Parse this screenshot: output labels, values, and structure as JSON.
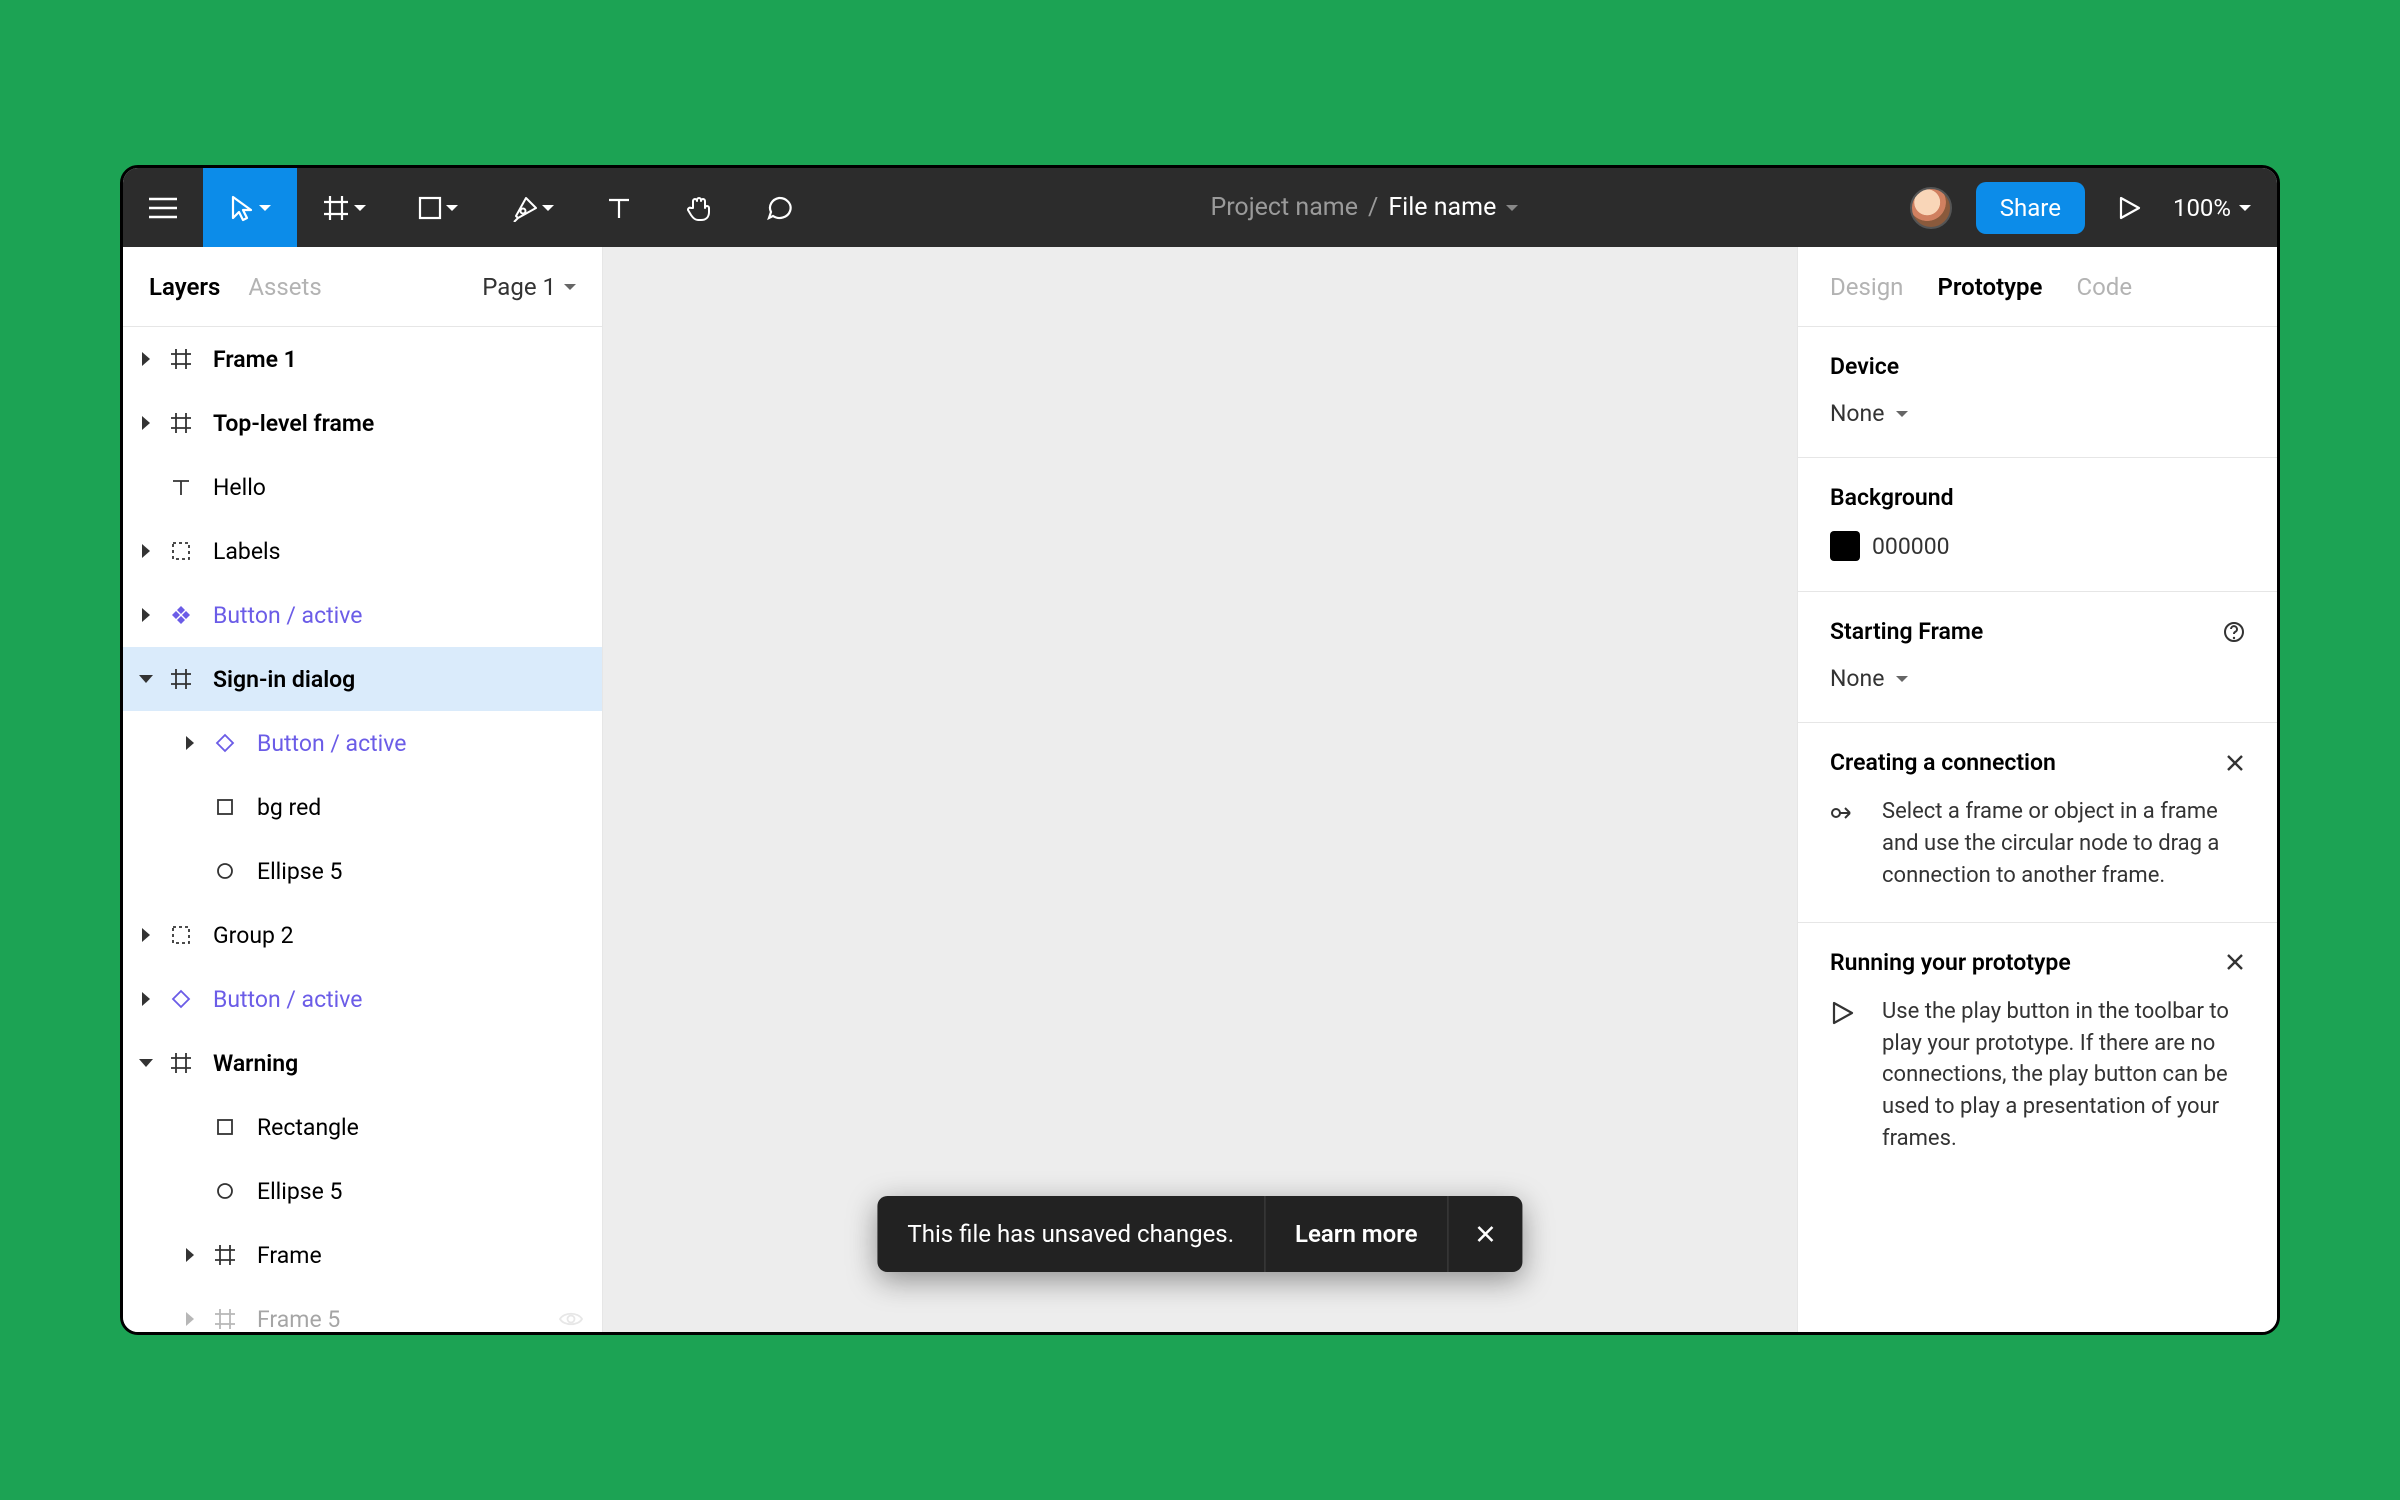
{
  "toolbar": {
    "project_name": "Project name",
    "file_separator": "/",
    "file_name": "File name",
    "share_label": "Share",
    "zoom": "100%"
  },
  "left": {
    "tabs": {
      "layers": "Layers",
      "assets": "Assets"
    },
    "page_label": "Page 1",
    "layers": [
      {
        "label": "Frame 1",
        "bold": true,
        "icon": "frame",
        "arrow": "right",
        "indent": 0
      },
      {
        "label": "Top-level frame",
        "bold": true,
        "icon": "frame",
        "arrow": "right",
        "indent": 0
      },
      {
        "label": "Hello",
        "icon": "text",
        "arrow": "none",
        "indent": 0
      },
      {
        "label": "Labels",
        "icon": "group",
        "arrow": "right",
        "indent": 0
      },
      {
        "label": "Button / active",
        "purple": true,
        "icon": "component-filled",
        "arrow": "right",
        "indent": 0
      },
      {
        "label": "Sign-in dialog",
        "bold": true,
        "icon": "frame",
        "arrow": "down",
        "indent": 0,
        "selected": true
      },
      {
        "label": "Button / active",
        "purple": true,
        "icon": "instance",
        "arrow": "right",
        "indent": 1
      },
      {
        "label": "bg red",
        "icon": "rect",
        "arrow": "none",
        "indent": 1
      },
      {
        "label": "Ellipse 5",
        "icon": "ellipse",
        "arrow": "none",
        "indent": 1
      },
      {
        "label": "Group 2",
        "icon": "group",
        "arrow": "right",
        "indent": 0
      },
      {
        "label": "Button / active",
        "purple": true,
        "icon": "instance",
        "arrow": "right",
        "indent": 0
      },
      {
        "label": "Warning",
        "bold": true,
        "icon": "frame",
        "arrow": "down",
        "indent": 0
      },
      {
        "label": "Rectangle",
        "icon": "rect",
        "arrow": "none",
        "indent": 1
      },
      {
        "label": "Ellipse 5",
        "icon": "ellipse",
        "arrow": "none",
        "indent": 1
      },
      {
        "label": "Frame",
        "icon": "frame",
        "arrow": "right",
        "indent": 1
      },
      {
        "label": "Frame 5",
        "icon": "frame",
        "arrow": "right",
        "indent": 1,
        "faded": true,
        "eye": true
      }
    ]
  },
  "right": {
    "tabs": {
      "design": "Design",
      "prototype": "Prototype",
      "code": "Code"
    },
    "device": {
      "title": "Device",
      "value": "None"
    },
    "background": {
      "title": "Background",
      "value": "000000"
    },
    "starting_frame": {
      "title": "Starting Frame",
      "value": "None"
    },
    "info1": {
      "title": "Creating a connection",
      "text": "Select a frame or object in a frame and use the circular node to drag a connection to another frame."
    },
    "info2": {
      "title": "Running your prototype",
      "text": "Use the play button in the toolbar to play your prototype. If there are no connections, the play button can be used to play a presentation of your frames."
    }
  },
  "toast": {
    "message": "This file has unsaved changes.",
    "action": "Learn more"
  }
}
